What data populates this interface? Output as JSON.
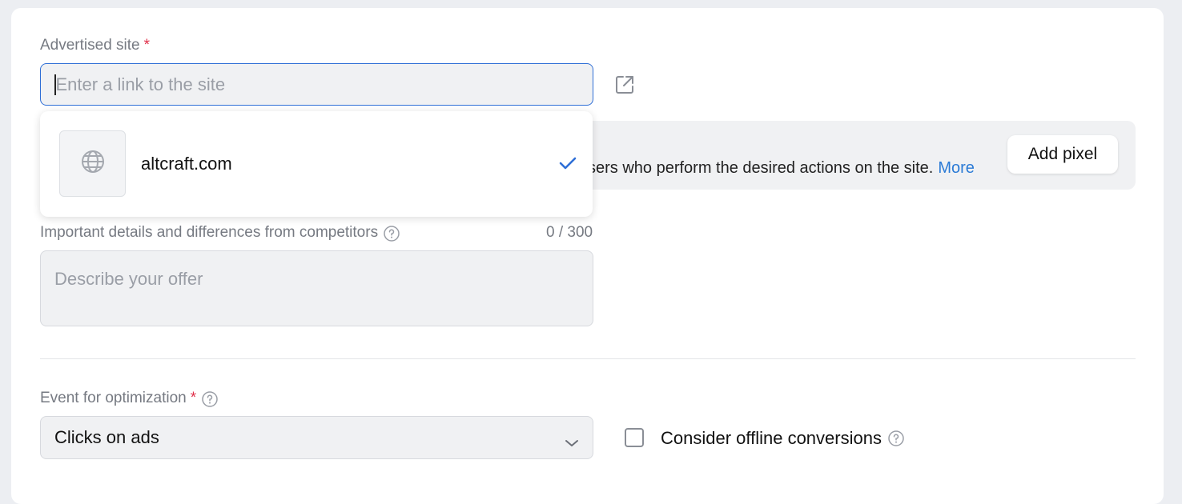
{
  "site": {
    "label": "Advertised site",
    "required_mark": "*",
    "placeholder": "Enter a link to the site",
    "suggestion": "altcraft.com"
  },
  "pixel_banner": {
    "text_visible": "sers who perform the desired actions on the site.",
    "more_link": "More",
    "add_pixel_button": "Add pixel"
  },
  "details": {
    "label": "Important details and differences from competitors",
    "counter": "0 / 300",
    "placeholder": "Describe your offer"
  },
  "event": {
    "label": "Event for optimization",
    "required_mark": "*",
    "selected": "Clicks on ads"
  },
  "offline": {
    "label": "Consider offline conversions",
    "checked": false
  },
  "colors": {
    "accent": "#2f6fd6",
    "link": "#2b7bd6",
    "required": "#e0314b"
  },
  "icons": [
    "external-link-icon",
    "globe-icon",
    "check-icon",
    "help-icon",
    "chevron-down-icon"
  ]
}
